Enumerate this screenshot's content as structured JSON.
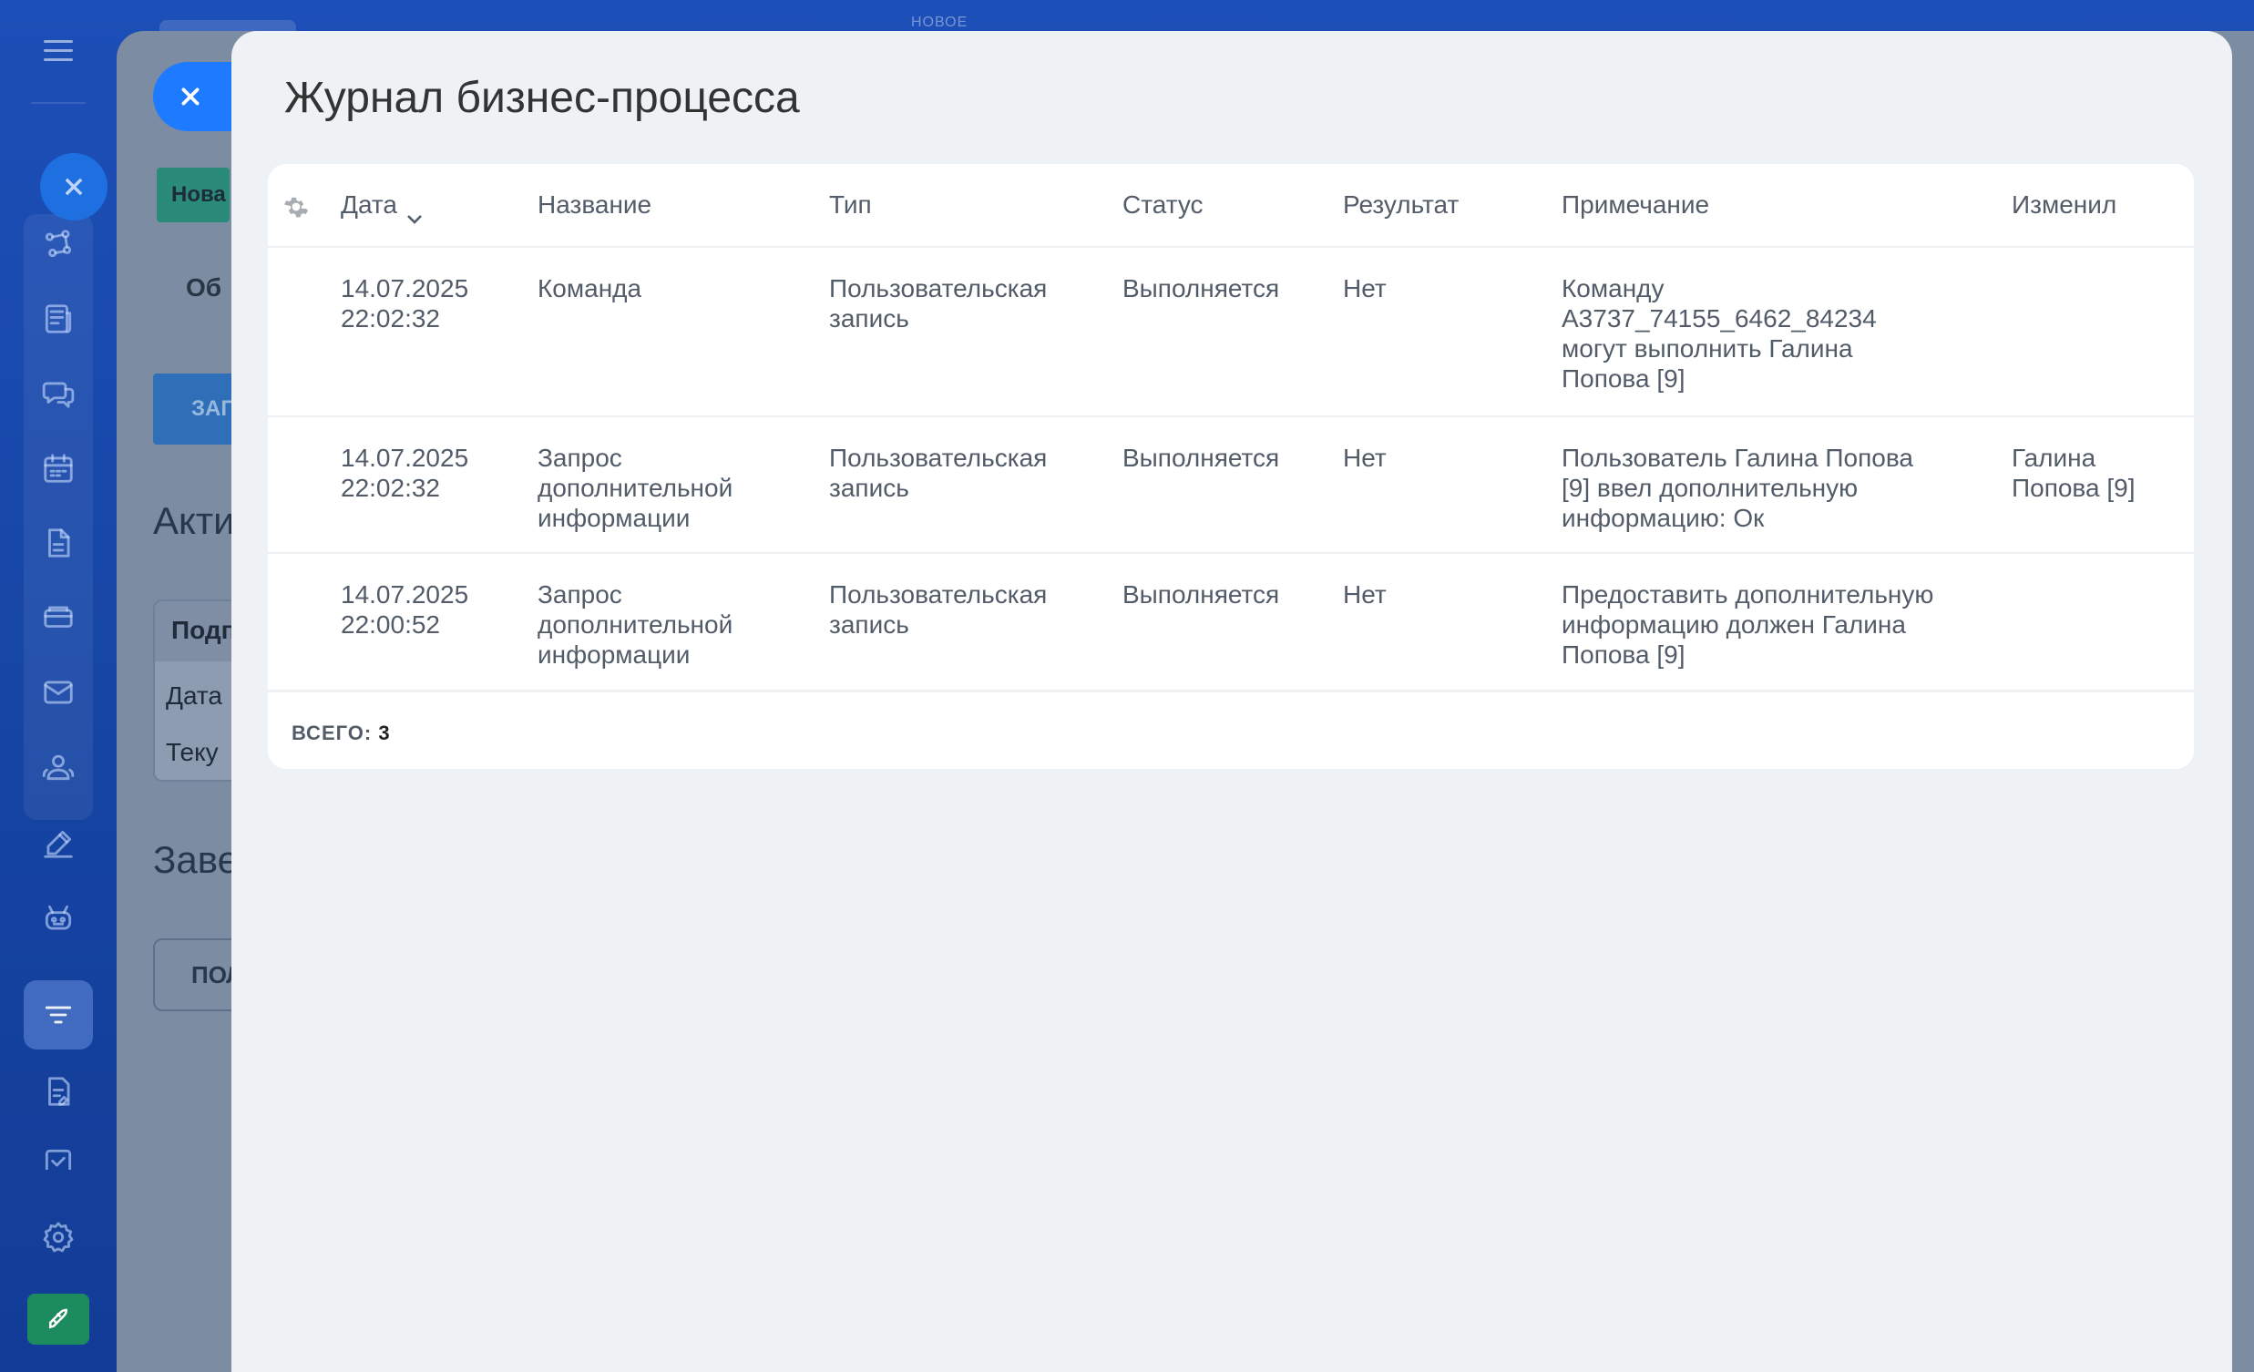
{
  "background": {
    "top_label": "НОВОЕ",
    "stage_badge": "Нова",
    "tab_label": "Об",
    "button_label": "ЗАГ",
    "section_activity": "Акти",
    "card_header": "Подп",
    "card_line1": "Дата",
    "card_line2": "Теку",
    "section_completed": "Заве",
    "button2_label": "ПОЛ"
  },
  "sidebar": {
    "items": [
      "hamburger-icon",
      "funnel-icon",
      "news-icon",
      "chat-icon",
      "calendar-icon",
      "document-icon",
      "card-icon",
      "mail-icon",
      "contacts-icon",
      "sign-icon",
      "robot-icon",
      "crm-filter-icon",
      "tasks-icon",
      "check-icon",
      "settings-icon",
      "rocket-icon"
    ]
  },
  "slider": {
    "title": "Журнал бизнес-процесса"
  },
  "grid": {
    "columns": {
      "date": "Дата",
      "name": "Название",
      "type": "Тип",
      "status": "Статус",
      "result": "Результат",
      "note": "Примечание",
      "modified_by": "Изменил"
    },
    "rows": [
      {
        "date": "14.07.2025",
        "time": "22:02:32",
        "name": "Команда",
        "type_l1": "Пользовательская",
        "type_l2": "запись",
        "status": "Выполняется",
        "result": "Нет",
        "note_l1": "Команду",
        "note_l2": "A3737_74155_6462_84234",
        "note_l3": "могут выполнить Галина",
        "note_l4": "Попова [9]",
        "mod_l1": "",
        "mod_l2": ""
      },
      {
        "date": "14.07.2025",
        "time": "22:02:32",
        "name_l1": "Запрос",
        "name_l2": "дополнительной",
        "name_l3": "информации",
        "type_l1": "Пользовательская",
        "type_l2": "запись",
        "status": "Выполняется",
        "result": "Нет",
        "note_l1": "Пользователь Галина Попова",
        "note_l2": "[9] ввел дополнительную",
        "note_l3": "информацию: Ок",
        "mod_l1": "Галина",
        "mod_l2": "Попова [9]"
      },
      {
        "date": "14.07.2025",
        "time": "22:00:52",
        "name_l1": "Запрос",
        "name_l2": "дополнительной",
        "name_l3": "информации",
        "type_l1": "Пользовательская",
        "type_l2": "запись",
        "status": "Выполняется",
        "result": "Нет",
        "note_l1": "Предоставить дополнительную",
        "note_l2": "информацию должен Галина",
        "note_l3": "Попова [9]",
        "mod_l1": "",
        "mod_l2": ""
      }
    ],
    "total_label": "ВСЕГО:",
    "total_count": "3"
  },
  "colors": {
    "accent_blue": "#1e7bff",
    "sidebar_bg": "#1d4fb8",
    "panel_bg": "#eef2f4",
    "text": "#525c69",
    "rocket_green": "#1c8b5e"
  }
}
